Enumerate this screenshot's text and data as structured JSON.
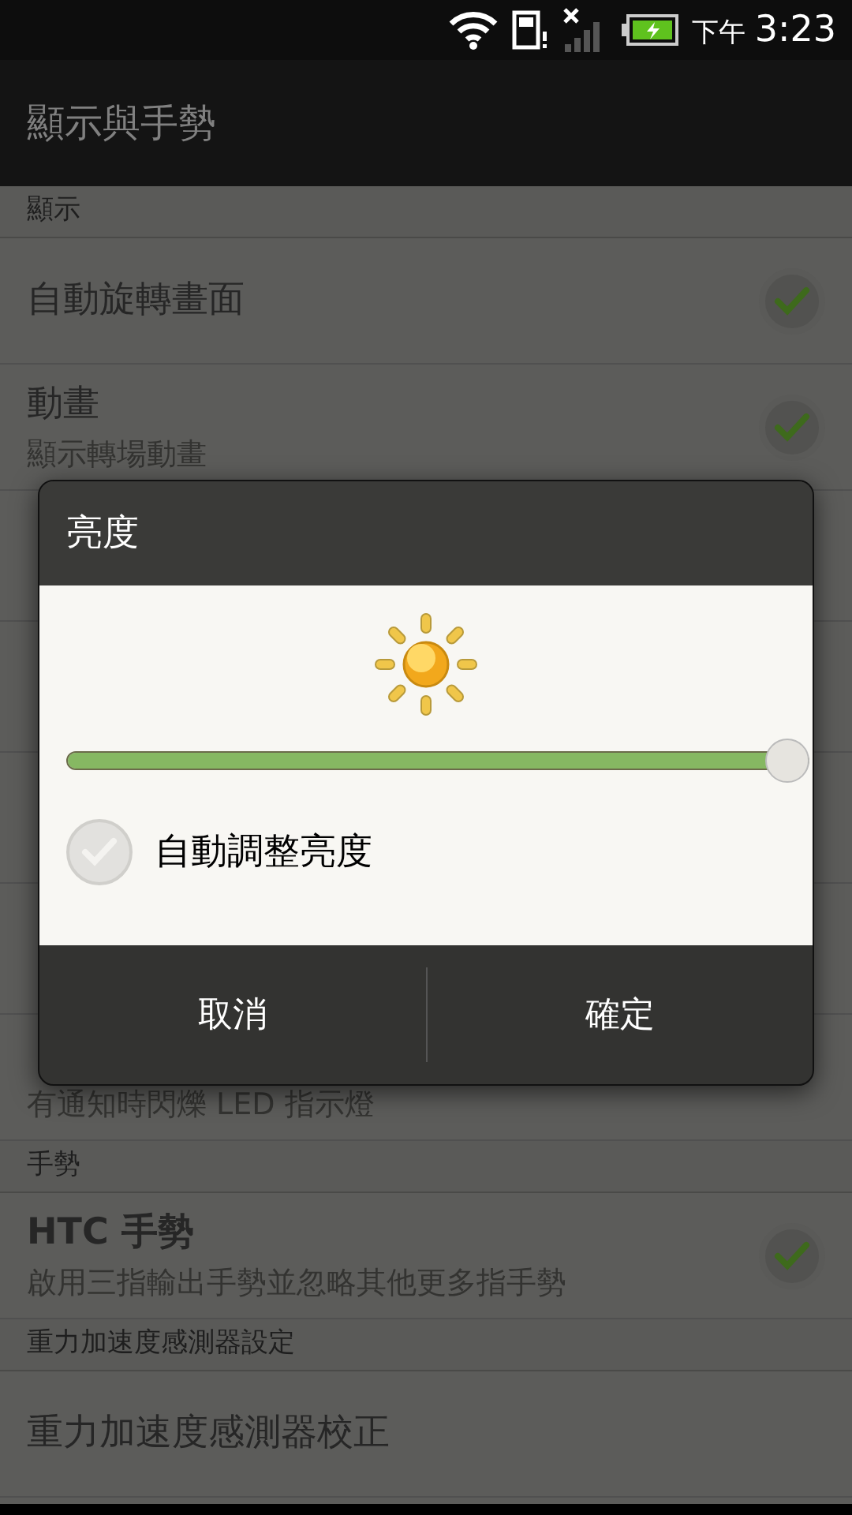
{
  "status_bar": {
    "time_period": "下午",
    "time": "3:23"
  },
  "app_bar": {
    "title": "顯示與手勢"
  },
  "list": [
    {
      "kind": "section",
      "title": "顯示"
    },
    {
      "kind": "setting",
      "title": "自動旋轉畫面",
      "checked": true
    },
    {
      "kind": "setting",
      "title": "動畫",
      "subtitle": "顯示轉場動畫",
      "checked": true
    },
    {
      "kind": "covered"
    },
    {
      "kind": "covered"
    },
    {
      "kind": "covered"
    },
    {
      "kind": "covered"
    },
    {
      "kind": "setting",
      "subtitle": "有通知時閃爍 LED 指示燈"
    },
    {
      "kind": "section",
      "title": "手勢"
    },
    {
      "kind": "setting",
      "title": "HTC 手勢",
      "subtitle": "啟用三指輸出手勢並忽略其他更多指手勢",
      "checked": true
    },
    {
      "kind": "section",
      "title": "重力加速度感測器設定"
    },
    {
      "kind": "setting",
      "title": "重力加速度感測器校正"
    }
  ],
  "dialog": {
    "title": "亮度",
    "brightness": {
      "level": 1.0
    },
    "auto_brightness": {
      "label": "自動調整亮度",
      "checked": false
    },
    "buttons": [
      "取消",
      "確定"
    ]
  }
}
